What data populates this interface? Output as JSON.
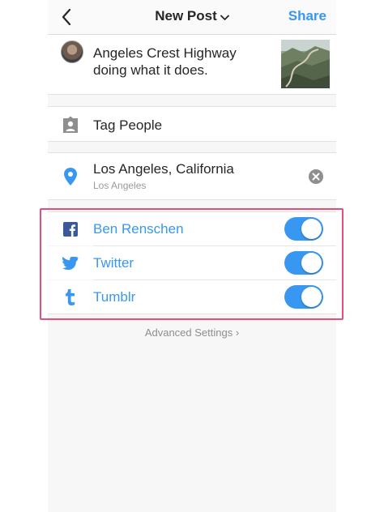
{
  "header": {
    "title": "New Post",
    "share_label": "Share"
  },
  "post": {
    "caption": "Angeles Crest Highway doing what it does."
  },
  "tag_people": {
    "label": "Tag People"
  },
  "location": {
    "name": "Los Angeles, California",
    "subtitle": "Los Angeles"
  },
  "share_targets": [
    {
      "label": "Ben Renschen",
      "icon": "facebook-icon",
      "enabled": true
    },
    {
      "label": "Twitter",
      "icon": "twitter-icon",
      "enabled": true
    },
    {
      "label": "Tumblr",
      "icon": "tumblr-icon",
      "enabled": true
    }
  ],
  "advanced": {
    "label": "Advanced Settings ›"
  },
  "colors": {
    "accent": "#3897f0",
    "highlight_border": "#e64d78",
    "text": "#262626",
    "muted": "#8e8e8e"
  }
}
